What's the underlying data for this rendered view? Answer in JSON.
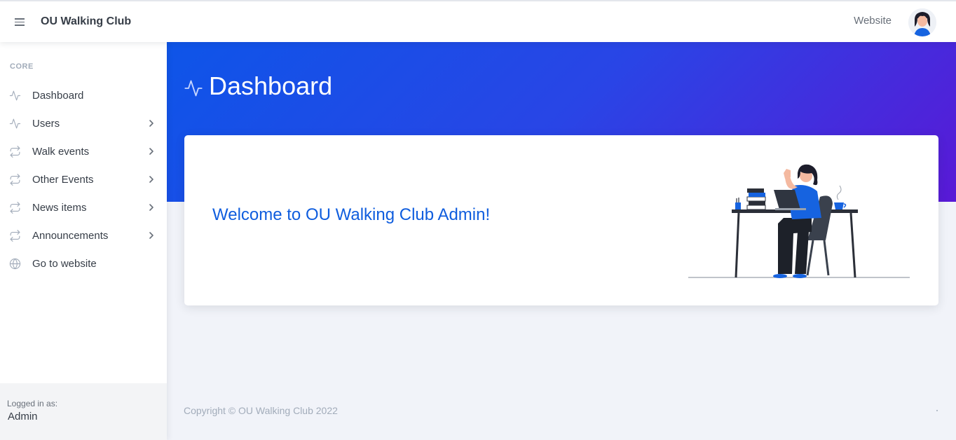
{
  "topbar": {
    "brand": "OU Walking Club",
    "website_link": "Website"
  },
  "sidenav": {
    "heading": "CORE",
    "items": [
      {
        "label": "Dashboard",
        "icon": "activity-icon",
        "has_children": false
      },
      {
        "label": "Users",
        "icon": "activity-icon",
        "has_children": true
      },
      {
        "label": "Walk events",
        "icon": "repeat-icon",
        "has_children": true
      },
      {
        "label": "Other Events",
        "icon": "repeat-icon",
        "has_children": true
      },
      {
        "label": "News items",
        "icon": "repeat-icon",
        "has_children": true
      },
      {
        "label": "Announcements",
        "icon": "repeat-icon",
        "has_children": true
      },
      {
        "label": "Go to website",
        "icon": "globe-icon",
        "has_children": false
      }
    ],
    "footer": {
      "subtitle": "Logged in as:",
      "title": "Admin"
    }
  },
  "page": {
    "title": "Dashboard",
    "welcome": "Welcome to OU Walking Club Admin!"
  },
  "footer": {
    "copyright": "Copyright © OU Walking Club 2022"
  },
  "colors": {
    "primary": "#0f5dde",
    "gradient_start": "#0e55e8",
    "gradient_end": "#5919d6"
  }
}
